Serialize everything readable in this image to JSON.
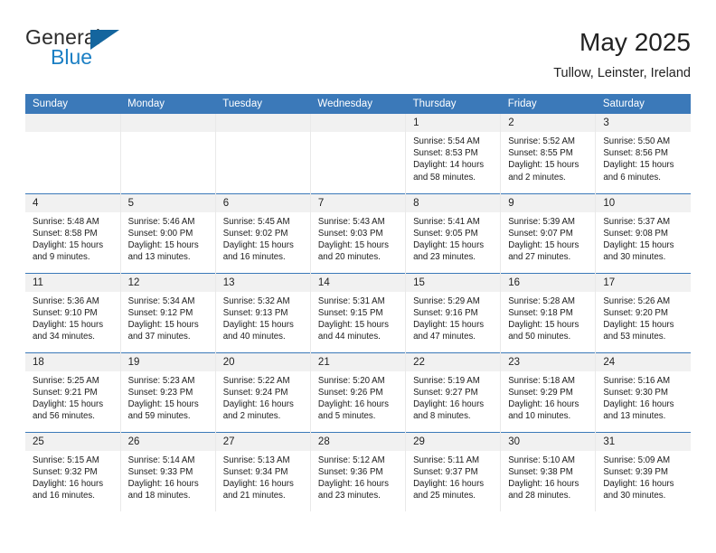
{
  "logo": {
    "primary_text": "General",
    "secondary_text": "Blue",
    "accent_color": "#14659e",
    "secondary_color": "#1b7fc4"
  },
  "header": {
    "title": "May 2025",
    "location": "Tullow, Leinster, Ireland"
  },
  "calendar": {
    "header_color": "#3b79b9",
    "daynum_bg": "#f1f1f1",
    "weekday_headers": [
      "Sunday",
      "Monday",
      "Tuesday",
      "Wednesday",
      "Thursday",
      "Friday",
      "Saturday"
    ],
    "weeks": [
      [
        {
          "day": "",
          "sunrise": "",
          "sunset": "",
          "daylight": ""
        },
        {
          "day": "",
          "sunrise": "",
          "sunset": "",
          "daylight": ""
        },
        {
          "day": "",
          "sunrise": "",
          "sunset": "",
          "daylight": ""
        },
        {
          "day": "",
          "sunrise": "",
          "sunset": "",
          "daylight": ""
        },
        {
          "day": "1",
          "sunrise": "Sunrise: 5:54 AM",
          "sunset": "Sunset: 8:53 PM",
          "daylight": "Daylight: 14 hours and 58 minutes."
        },
        {
          "day": "2",
          "sunrise": "Sunrise: 5:52 AM",
          "sunset": "Sunset: 8:55 PM",
          "daylight": "Daylight: 15 hours and 2 minutes."
        },
        {
          "day": "3",
          "sunrise": "Sunrise: 5:50 AM",
          "sunset": "Sunset: 8:56 PM",
          "daylight": "Daylight: 15 hours and 6 minutes."
        }
      ],
      [
        {
          "day": "4",
          "sunrise": "Sunrise: 5:48 AM",
          "sunset": "Sunset: 8:58 PM",
          "daylight": "Daylight: 15 hours and 9 minutes."
        },
        {
          "day": "5",
          "sunrise": "Sunrise: 5:46 AM",
          "sunset": "Sunset: 9:00 PM",
          "daylight": "Daylight: 15 hours and 13 minutes."
        },
        {
          "day": "6",
          "sunrise": "Sunrise: 5:45 AM",
          "sunset": "Sunset: 9:02 PM",
          "daylight": "Daylight: 15 hours and 16 minutes."
        },
        {
          "day": "7",
          "sunrise": "Sunrise: 5:43 AM",
          "sunset": "Sunset: 9:03 PM",
          "daylight": "Daylight: 15 hours and 20 minutes."
        },
        {
          "day": "8",
          "sunrise": "Sunrise: 5:41 AM",
          "sunset": "Sunset: 9:05 PM",
          "daylight": "Daylight: 15 hours and 23 minutes."
        },
        {
          "day": "9",
          "sunrise": "Sunrise: 5:39 AM",
          "sunset": "Sunset: 9:07 PM",
          "daylight": "Daylight: 15 hours and 27 minutes."
        },
        {
          "day": "10",
          "sunrise": "Sunrise: 5:37 AM",
          "sunset": "Sunset: 9:08 PM",
          "daylight": "Daylight: 15 hours and 30 minutes."
        }
      ],
      [
        {
          "day": "11",
          "sunrise": "Sunrise: 5:36 AM",
          "sunset": "Sunset: 9:10 PM",
          "daylight": "Daylight: 15 hours and 34 minutes."
        },
        {
          "day": "12",
          "sunrise": "Sunrise: 5:34 AM",
          "sunset": "Sunset: 9:12 PM",
          "daylight": "Daylight: 15 hours and 37 minutes."
        },
        {
          "day": "13",
          "sunrise": "Sunrise: 5:32 AM",
          "sunset": "Sunset: 9:13 PM",
          "daylight": "Daylight: 15 hours and 40 minutes."
        },
        {
          "day": "14",
          "sunrise": "Sunrise: 5:31 AM",
          "sunset": "Sunset: 9:15 PM",
          "daylight": "Daylight: 15 hours and 44 minutes."
        },
        {
          "day": "15",
          "sunrise": "Sunrise: 5:29 AM",
          "sunset": "Sunset: 9:16 PM",
          "daylight": "Daylight: 15 hours and 47 minutes."
        },
        {
          "day": "16",
          "sunrise": "Sunrise: 5:28 AM",
          "sunset": "Sunset: 9:18 PM",
          "daylight": "Daylight: 15 hours and 50 minutes."
        },
        {
          "day": "17",
          "sunrise": "Sunrise: 5:26 AM",
          "sunset": "Sunset: 9:20 PM",
          "daylight": "Daylight: 15 hours and 53 minutes."
        }
      ],
      [
        {
          "day": "18",
          "sunrise": "Sunrise: 5:25 AM",
          "sunset": "Sunset: 9:21 PM",
          "daylight": "Daylight: 15 hours and 56 minutes."
        },
        {
          "day": "19",
          "sunrise": "Sunrise: 5:23 AM",
          "sunset": "Sunset: 9:23 PM",
          "daylight": "Daylight: 15 hours and 59 minutes."
        },
        {
          "day": "20",
          "sunrise": "Sunrise: 5:22 AM",
          "sunset": "Sunset: 9:24 PM",
          "daylight": "Daylight: 16 hours and 2 minutes."
        },
        {
          "day": "21",
          "sunrise": "Sunrise: 5:20 AM",
          "sunset": "Sunset: 9:26 PM",
          "daylight": "Daylight: 16 hours and 5 minutes."
        },
        {
          "day": "22",
          "sunrise": "Sunrise: 5:19 AM",
          "sunset": "Sunset: 9:27 PM",
          "daylight": "Daylight: 16 hours and 8 minutes."
        },
        {
          "day": "23",
          "sunrise": "Sunrise: 5:18 AM",
          "sunset": "Sunset: 9:29 PM",
          "daylight": "Daylight: 16 hours and 10 minutes."
        },
        {
          "day": "24",
          "sunrise": "Sunrise: 5:16 AM",
          "sunset": "Sunset: 9:30 PM",
          "daylight": "Daylight: 16 hours and 13 minutes."
        }
      ],
      [
        {
          "day": "25",
          "sunrise": "Sunrise: 5:15 AM",
          "sunset": "Sunset: 9:32 PM",
          "daylight": "Daylight: 16 hours and 16 minutes."
        },
        {
          "day": "26",
          "sunrise": "Sunrise: 5:14 AM",
          "sunset": "Sunset: 9:33 PM",
          "daylight": "Daylight: 16 hours and 18 minutes."
        },
        {
          "day": "27",
          "sunrise": "Sunrise: 5:13 AM",
          "sunset": "Sunset: 9:34 PM",
          "daylight": "Daylight: 16 hours and 21 minutes."
        },
        {
          "day": "28",
          "sunrise": "Sunrise: 5:12 AM",
          "sunset": "Sunset: 9:36 PM",
          "daylight": "Daylight: 16 hours and 23 minutes."
        },
        {
          "day": "29",
          "sunrise": "Sunrise: 5:11 AM",
          "sunset": "Sunset: 9:37 PM",
          "daylight": "Daylight: 16 hours and 25 minutes."
        },
        {
          "day": "30",
          "sunrise": "Sunrise: 5:10 AM",
          "sunset": "Sunset: 9:38 PM",
          "daylight": "Daylight: 16 hours and 28 minutes."
        },
        {
          "day": "31",
          "sunrise": "Sunrise: 5:09 AM",
          "sunset": "Sunset: 9:39 PM",
          "daylight": "Daylight: 16 hours and 30 minutes."
        }
      ]
    ]
  }
}
